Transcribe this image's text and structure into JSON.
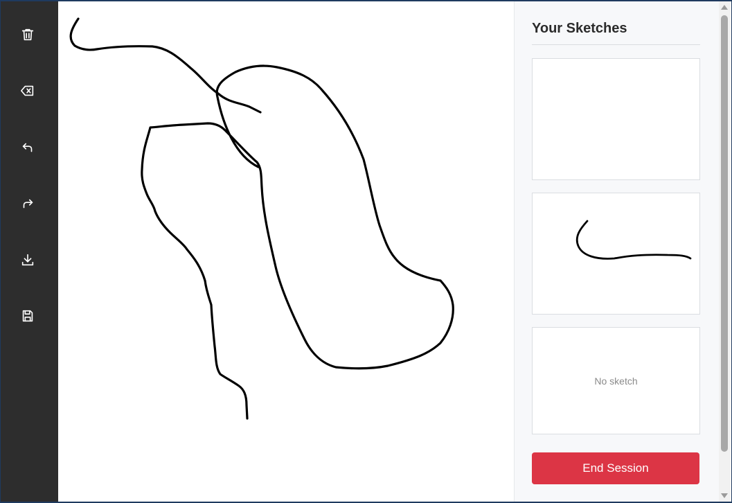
{
  "toolbar": {
    "tools": [
      {
        "name": "delete",
        "icon": "trash-icon"
      },
      {
        "name": "clear",
        "icon": "backspace-icon"
      },
      {
        "name": "undo",
        "icon": "undo-icon"
      },
      {
        "name": "redo",
        "icon": "redo-icon"
      },
      {
        "name": "download",
        "icon": "download-icon"
      },
      {
        "name": "save",
        "icon": "save-icon"
      }
    ]
  },
  "sidebar": {
    "title": "Your Sketches",
    "sketches": [
      {
        "state": "blank"
      },
      {
        "state": "drawn"
      },
      {
        "state": "empty",
        "label": "No sketch"
      }
    ],
    "end_session_label": "End Session"
  },
  "colors": {
    "toolbar_bg": "#2d2d2d",
    "panel_bg": "#f7f8fa",
    "accent_red": "#dc3545",
    "stroke": "#000000"
  }
}
